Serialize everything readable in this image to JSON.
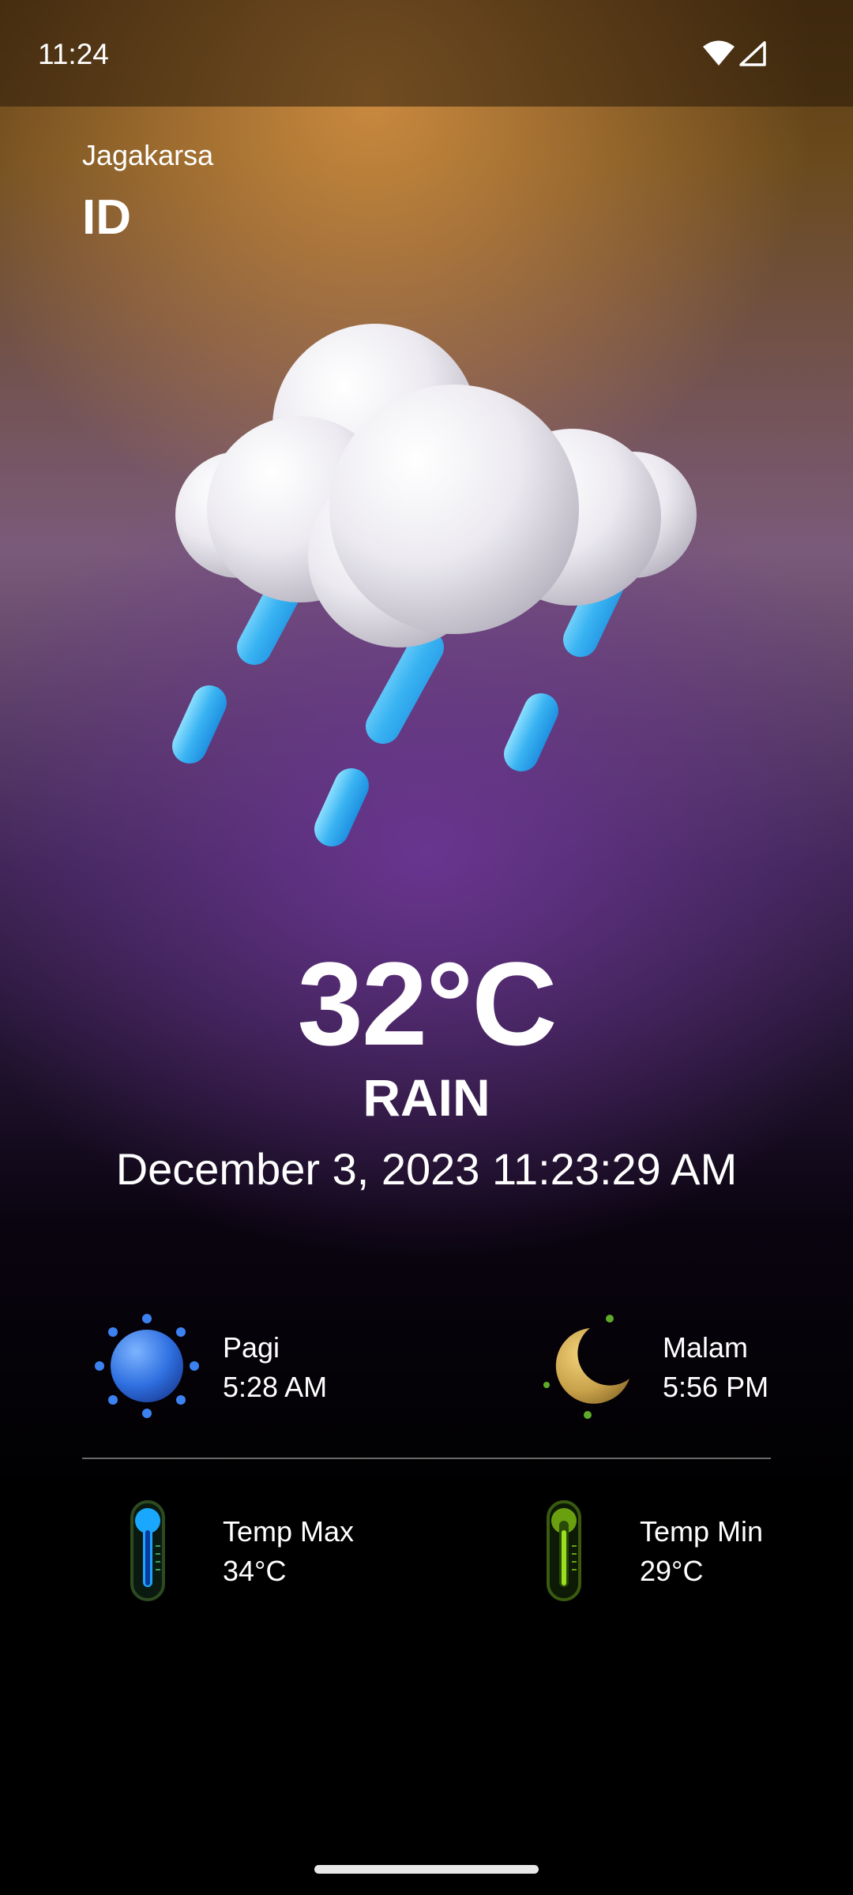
{
  "status_bar": {
    "time": "11:24"
  },
  "location": {
    "city": "Jagakarsa",
    "country": "ID"
  },
  "weather": {
    "temperature": "32°C",
    "condition": "RAIN",
    "datetime": "December 3, 2023 11:23:29 AM",
    "icon": "rain-cloud-icon"
  },
  "sun": {
    "sunrise_label": "Pagi",
    "sunrise_time": "5:28 AM",
    "sunset_label": "Malam",
    "sunset_time": "5:56 PM"
  },
  "temperature_range": {
    "max_label": "Temp Max",
    "max_value": "34°C",
    "min_label": "Temp Min",
    "min_value": "29°C"
  },
  "colors": {
    "rain": "#3ab4f0",
    "sunrise": "#2f6fe0",
    "sunset": "#c9a24a",
    "min_thermo": "#9be020",
    "max_thermo": "#1aa8ff"
  }
}
